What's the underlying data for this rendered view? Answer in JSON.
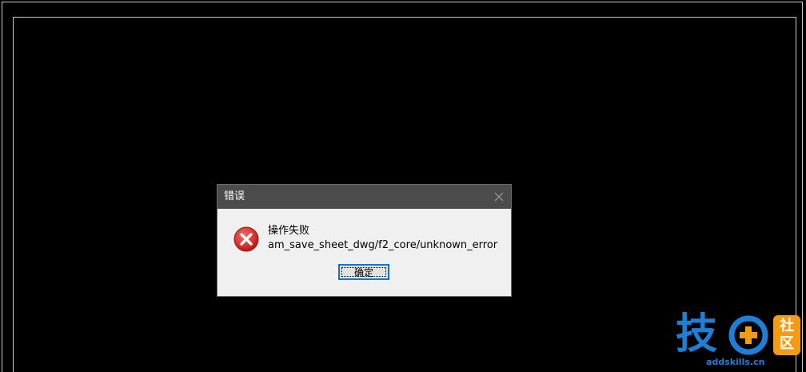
{
  "dialog": {
    "title": "错误",
    "message_line1": "操作失败",
    "message_line2": "am_save_sheet_dwg/f2_core/unknown_error",
    "ok_label": "确定",
    "icon": "error-icon",
    "close_icon": "close-icon"
  },
  "watermark": {
    "main_char": "技",
    "side_char1": "社",
    "side_char2": "区",
    "url": "addskills.cn"
  },
  "colors": {
    "background": "#000000",
    "titlebar": "#4b4b4b",
    "dialog_body": "#f0f0f0",
    "error_red": "#d9302c",
    "button_focus": "#0078d7",
    "watermark_blue": "#1e7fd6",
    "watermark_orange": "#f39c12"
  }
}
